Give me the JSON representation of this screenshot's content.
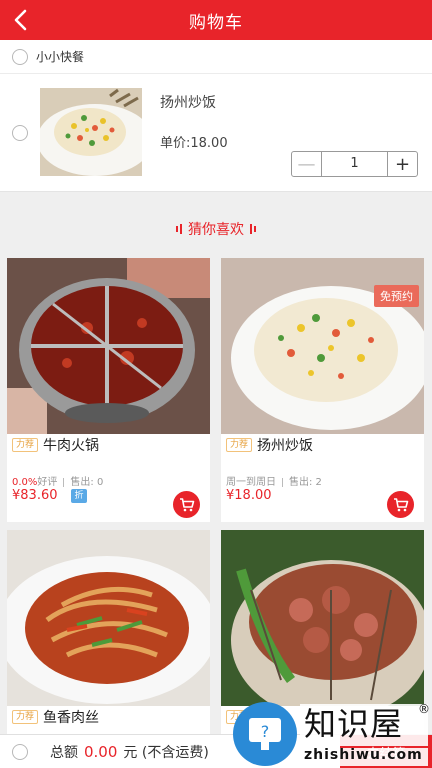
{
  "header": {
    "title": "购物车"
  },
  "shop": {
    "name": "小小快餐"
  },
  "cart_item": {
    "name": "扬州炒饭",
    "price_label": "单价:18.00",
    "quantity": "1",
    "minus": "—",
    "plus": "+"
  },
  "guess_title": "猜你喜欢",
  "products": [
    {
      "tag": "力荐",
      "name": "牛肉火锅",
      "rating": "0.0%",
      "rating_suffix": "好评",
      "sold": "售出: 0",
      "price": "¥83.60",
      "discount": "折"
    },
    {
      "tag": "力荐",
      "name": "扬州炒饭",
      "schedule": "周一到周日",
      "sold": "售出: 2",
      "price": "¥18.00",
      "badge": "免预约"
    },
    {
      "tag": "力荐",
      "name": "鱼香肉丝"
    },
    {
      "tag": "力荐",
      "name": ""
    }
  ],
  "footer": {
    "total_label": "总额",
    "total_amount": "0.00",
    "total_unit": "元 (不含运费)",
    "checkout": "去结算"
  },
  "watermark": {
    "brand": "知识屋",
    "domain": "zhishiwu.com",
    "registered": "®"
  },
  "colors": {
    "brand_red": "#e8242a",
    "background": "#efefef",
    "tag_orange": "#e7a23f",
    "discount_blue": "#5aa9e6"
  }
}
